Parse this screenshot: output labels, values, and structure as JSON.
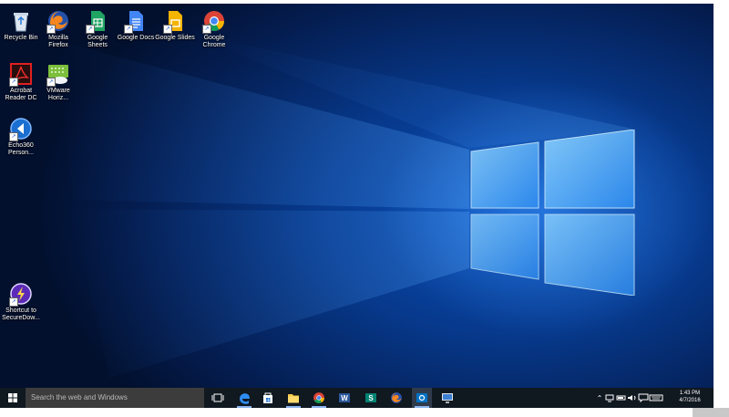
{
  "desktop": {
    "icons": [
      {
        "label_line1": "Recycle Bin",
        "label_line2": "",
        "icon": "recycle-bin-icon"
      },
      {
        "label_line1": "Mozilla",
        "label_line2": "Firefox",
        "icon": "firefox-icon"
      },
      {
        "label_line1": "Google",
        "label_line2": "Sheets",
        "icon": "google-sheets-icon"
      },
      {
        "label_line1": "Google Docs",
        "label_line2": "",
        "icon": "google-docs-icon"
      },
      {
        "label_line1": "Google Slides",
        "label_line2": "",
        "icon": "google-slides-icon"
      },
      {
        "label_line1": "Google",
        "label_line2": "Chrome",
        "icon": "chrome-icon"
      },
      {
        "label_line1": "Acrobat",
        "label_line2": "Reader DC",
        "icon": "acrobat-reader-icon"
      },
      {
        "label_line1": "VMware",
        "label_line2": "Horiz...",
        "icon": "vmware-horizon-icon"
      },
      {
        "label_line1": "Echo360",
        "label_line2": "Person...",
        "icon": "echo360-icon"
      },
      {
        "label_line1": "Shortcut to",
        "label_line2": "SecureDow...",
        "icon": "securedownload-icon"
      }
    ]
  },
  "taskbar": {
    "search_placeholder": "Search the web and Windows",
    "apps": [
      "task-view-icon",
      "edge-icon",
      "store-icon",
      "file-explorer-icon",
      "chrome-icon",
      "word-icon",
      "sway-icon",
      "firefox-icon",
      "outlook-icon",
      "remote-desktop-icon"
    ],
    "clock_time": "1:43 PM",
    "clock_date": "4/7/2016"
  },
  "colors": {
    "taskbar": "#101820",
    "search_box": "#3c3c3c",
    "accent": "#1a8cff",
    "wallpaper_dark": "#02102e"
  }
}
